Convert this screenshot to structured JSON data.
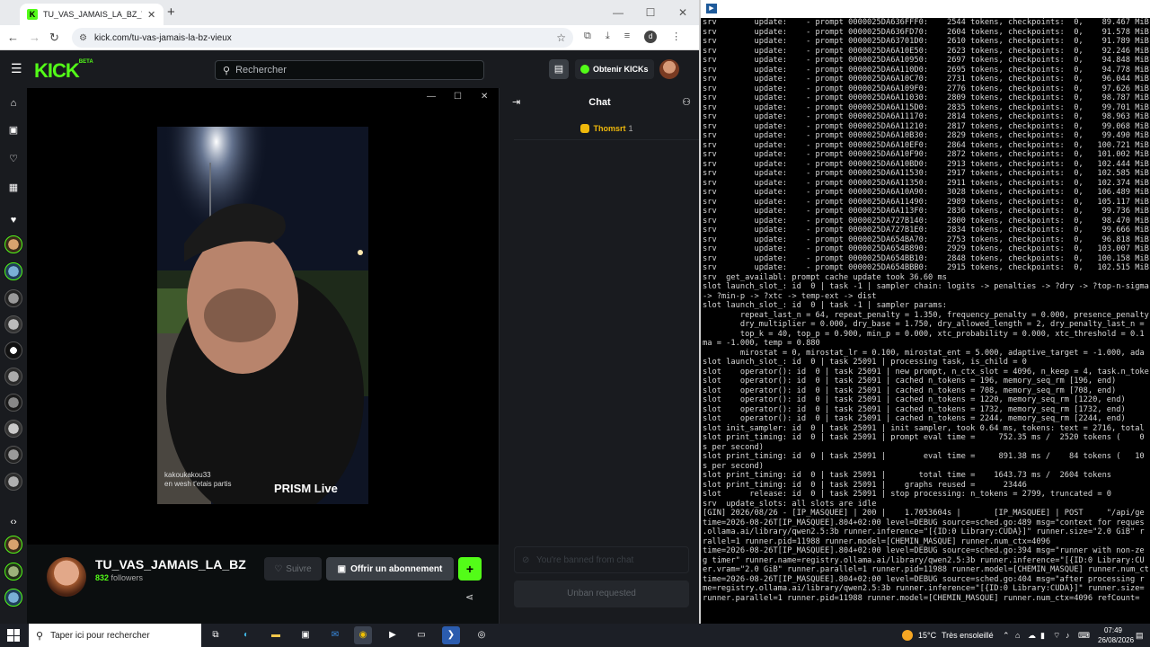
{
  "browser": {
    "tab_title": "TU_VAS_JAMAIS_LA_BZ_VIEUX",
    "tab_close": "✕",
    "new_tab": "+",
    "url": "kick.com/tu-vas-jamais-la-bz-vieux",
    "window_controls": [
      "—",
      "☐",
      "✕"
    ],
    "profile_initial": "d"
  },
  "kick": {
    "search_placeholder": "Rechercher",
    "get_kicks_label": "Obtenir KICKs",
    "player_controls": [
      "—",
      "☐",
      "✕"
    ],
    "video_overlay": {
      "username": "kakoukakou33",
      "caption": "en wesh t'etais partis",
      "watermark": "PRISM Live"
    },
    "channel": {
      "name": "TU_VAS_JAMAIS_LA_BZ",
      "followers_count": "832",
      "followers_label": "followers",
      "follow_label": "Suivre",
      "subscribe_label": "Offrir un abonnement",
      "plus_label": "+"
    },
    "chat": {
      "title": "Chat",
      "pinned_user": "Thomsrt",
      "pinned_count": "1",
      "input_placeholder": "You're banned from chat",
      "unban_label": "Unban requested"
    }
  },
  "terminal": {
    "lines": [
      "srv        update:    - prompt 0000025DA636FFF0:    2544 tokens, checkpoints:  0,    89.467 MiB",
      "srv        update:    - prompt 0000025DA636FD70:    2604 tokens, checkpoints:  0,    91.578 MiB",
      "srv        update:    - prompt 0000025DA63701D0:    2610 tokens, checkpoints:  0,    91.789 MiB",
      "srv        update:    - prompt 0000025DA6A10E50:    2623 tokens, checkpoints:  0,    92.246 MiB",
      "srv        update:    - prompt 0000025DA6A10950:    2697 tokens, checkpoints:  0,    94.848 MiB",
      "srv        update:    - prompt 0000025DA6A110D0:    2695 tokens, checkpoints:  0,    94.778 MiB",
      "srv        update:    - prompt 0000025DA6A10C70:    2731 tokens, checkpoints:  0,    96.044 MiB",
      "srv        update:    - prompt 0000025DA6A109F0:    2776 tokens, checkpoints:  0,    97.626 MiB",
      "srv        update:    - prompt 0000025DA6A11030:    2809 tokens, checkpoints:  0,    98.787 MiB",
      "srv        update:    - prompt 0000025DA6A115D0:    2835 tokens, checkpoints:  0,    99.701 MiB",
      "srv        update:    - prompt 0000025DA6A11170:    2814 tokens, checkpoints:  0,    98.963 MiB",
      "srv        update:    - prompt 0000025DA6A11210:    2817 tokens, checkpoints:  0,    99.068 MiB",
      "srv        update:    - prompt 0000025DA6A10B30:    2829 tokens, checkpoints:  0,    99.490 MiB",
      "srv        update:    - prompt 0000025DA6A10EF0:    2864 tokens, checkpoints:  0,   100.721 MiB",
      "srv        update:    - prompt 0000025DA6A10F90:    2872 tokens, checkpoints:  0,   101.002 MiB",
      "srv        update:    - prompt 0000025DA6A10BD0:    2913 tokens, checkpoints:  0,   102.444 MiB",
      "srv        update:    - prompt 0000025DA6A11530:    2917 tokens, checkpoints:  0,   102.585 MiB",
      "srv        update:    - prompt 0000025DA6A11350:    2911 tokens, checkpoints:  0,   102.374 MiB",
      "srv        update:    - prompt 0000025DA6A10A90:    3028 tokens, checkpoints:  0,   106.489 MiB",
      "srv        update:    - prompt 0000025DA6A11490:    2989 tokens, checkpoints:  0,   105.117 MiB",
      "srv        update:    - prompt 0000025DA6A113F0:    2836 tokens, checkpoints:  0,    99.736 MiB",
      "srv        update:    - prompt 0000025DA727B140:    2800 tokens, checkpoints:  0,    98.470 MiB",
      "srv        update:    - prompt 0000025DA727B1E0:    2834 tokens, checkpoints:  0,    99.666 MiB",
      "srv        update:    - prompt 0000025DA654BA70:    2753 tokens, checkpoints:  0,    96.818 MiB",
      "srv        update:    - prompt 0000025DA654B890:    2929 tokens, checkpoints:  0,   103.007 MiB",
      "srv        update:    - prompt 0000025DA654BB10:    2848 tokens, checkpoints:  0,   100.158 MiB",
      "srv        update:    - prompt 0000025DA654BBB0:    2915 tokens, checkpoints:  0,   102.515 MiB",
      "srv  get_availabl: prompt cache update took 36.60 ms",
      "slot launch_slot_: id  0 | task -1 | sampler chain: logits -> penalties -> ?dry -> ?top-n-sigma",
      "-> ?min-p -> ?xtc -> temp-ext -> dist",
      "slot launch_slot_: id  0 | task -1 | sampler params:",
      "        repeat_last_n = 64, repeat_penalty = 1.350, frequency_penalty = 0.000, presence_penalty",
      "        dry_multiplier = 0.000, dry_base = 1.750, dry_allowed_length = 2, dry_penalty_last_n =",
      "        top_k = 40, top_p = 0.900, min_p = 0.000, xtc_probability = 0.000, xtc_threshold = 0.1",
      "ma = -1.000, temp = 0.880",
      "        mirostat = 0, mirostat_lr = 0.100, mirostat_ent = 5.000, adaptive_target = -1.000, ada",
      "slot launch_slot_: id  0 | task 25091 | processing task, is_child = 0",
      "slot    operator(): id  0 | task 25091 | new prompt, n_ctx_slot = 4096, n_keep = 4, task.n_toke",
      "slot    operator(): id  0 | task 25091 | cached n_tokens = 196, memory_seq_rm [196, end)",
      "slot    operator(): id  0 | task 25091 | cached n_tokens = 708, memory_seq_rm [708, end)",
      "slot    operator(): id  0 | task 25091 | cached n_tokens = 1220, memory_seq_rm [1220, end)",
      "slot    operator(): id  0 | task 25091 | cached n_tokens = 1732, memory_seq_rm [1732, end)",
      "slot    operator(): id  0 | task 25091 | cached n_tokens = 2244, memory_seq_rm [2244, end)",
      "slot init_sampler: id  0 | task 25091 | init sampler, took 0.64 ms, tokens: text = 2716, total",
      "slot print_timing: id  0 | task 25091 | prompt eval time =     752.35 ms /  2520 tokens (    0",
      "s per second)",
      "slot print_timing: id  0 | task 25091 |        eval time =     891.38 ms /    84 tokens (   10",
      "s per second)",
      "slot print_timing: id  0 | task 25091 |       total time =    1643.73 ms /  2604 tokens",
      "slot print_timing: id  0 | task 25091 |    graphs reused =      23446",
      "slot      release: id  0 | task 25091 | stop processing: n_tokens = 2799, truncated = 0",
      "srv  update_slots: all slots are idle",
      "[GIN] 2026/08/26 - [IP_MASQUEE] | 200 |    1.7053604s |       [IP_MASQUEE] | POST     \"/api/ge",
      "time=2026-08-26T[IP_MASQUEE].804+02:00 level=DEBUG source=sched.go:489 msg=\"context for reques",
      ".ollama.ai/library/qwen2.5:3b runner.inference=\"[{ID:0 Library:CUDA}]\" runner.size=\"2.0 GiB\" r",
      "rallel=1 runner.pid=11988 runner.model=[CHEMIN_MASQUE] runner.num_ctx=4096",
      "time=2026-08-26T[IP_MASQUEE].804+02:00 level=DEBUG source=sched.go:394 msg=\"runner with non-ze",
      "g timer\" runner.name=registry.ollama.ai/library/qwen2.5:3b runner.inference=\"[{ID:0 Library:CU",
      "er.vram=\"2.0 GiB\" runner.parallel=1 runner.pid=11988 runner.model=[CHEMIN_MASQUE] runner.num_ct",
      "time=2026-08-26T[IP_MASQUEE].804+02:00 level=DEBUG source=sched.go:404 msg=\"after processing r",
      "me=registry.ollama.ai/library/qwen2.5:3b runner.inference=\"[{ID:0 Library:CUDA}]\" runner.size=",
      "runner.parallel=1 runner.pid=11988 runner.model=[CHEMIN_MASQUE] runner.num_ctx=4096 refCount="
    ]
  },
  "taskbar": {
    "search_placeholder": "Taper ici pour rechercher",
    "weather_temp": "15°C",
    "weather_desc": "Très ensoleillé",
    "time": "07:49",
    "date": "26/08/2026"
  },
  "colors": {
    "kick_green": "#53fc18",
    "kick_bg": "#0b0e0f",
    "kick_panel": "#191b1f",
    "gold": "#f0b90b"
  }
}
